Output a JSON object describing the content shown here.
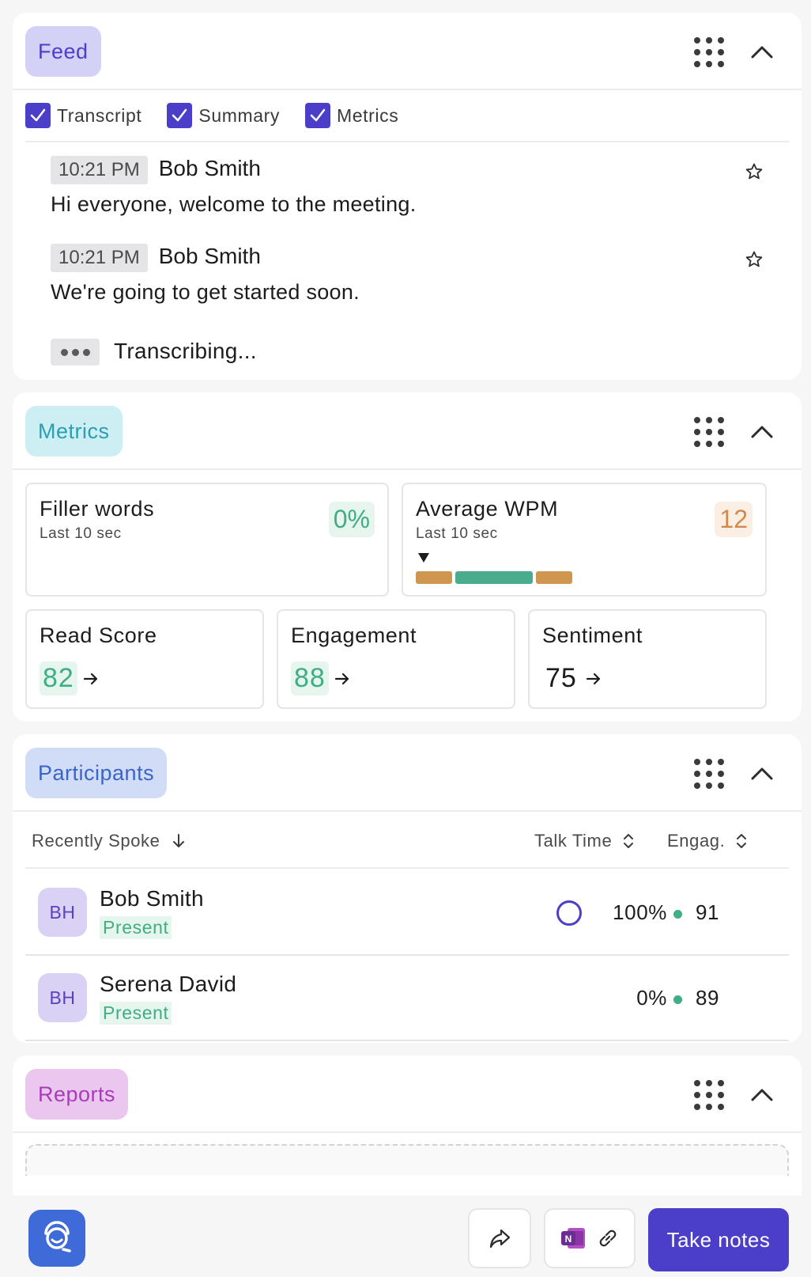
{
  "feed": {
    "title": "Feed",
    "filters": [
      "Transcript",
      "Summary",
      "Metrics"
    ],
    "messages": [
      {
        "time": "10:21 PM",
        "speaker": "Bob Smith",
        "text": "Hi everyone, welcome to the meeting."
      },
      {
        "time": "10:21 PM",
        "speaker": "Bob Smith",
        "text": "We're going to get started soon."
      }
    ],
    "transcribing": "Transcribing..."
  },
  "metrics": {
    "title": "Metrics",
    "filler": {
      "title": "Filler words",
      "sub": "Last 10 sec",
      "value": "0%"
    },
    "wpm": {
      "title": "Average WPM",
      "sub": "Last 10 sec",
      "value": "12",
      "marker_position": 0.05
    },
    "read": {
      "title": "Read Score",
      "value": "82"
    },
    "engagement": {
      "title": "Engagement",
      "value": "88"
    },
    "sentiment": {
      "title": "Sentiment",
      "value": "75"
    },
    "colors": {
      "green": "#3fae83",
      "orange": "#d08a4e",
      "bar_green": "#4aac8c",
      "bar_orange": "#cf9650"
    }
  },
  "participants": {
    "title": "Participants",
    "headers": {
      "name": "Recently Spoke",
      "talk": "Talk Time",
      "eng": "Engag."
    },
    "rows": [
      {
        "initials": "BH",
        "name": "Bob Smith",
        "status": "Present",
        "talk": "100%",
        "eng": "91"
      },
      {
        "initials": "BH",
        "name": "Serena David",
        "status": "Present",
        "talk": "0%",
        "eng": "89"
      }
    ]
  },
  "reports": {
    "title": "Reports"
  },
  "toolbar": {
    "take_notes": "Take notes",
    "onenote_label": "N"
  },
  "accent": "#4b3fc9"
}
